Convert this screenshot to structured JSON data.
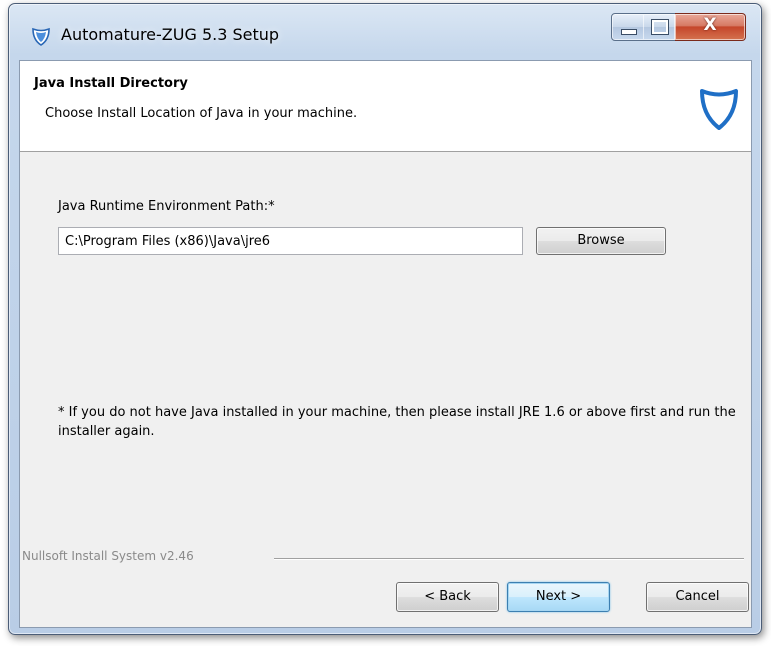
{
  "window": {
    "title": "Automature-ZUG 5.3 Setup",
    "controls": {
      "minimize": "minimize",
      "maximize": "maximize",
      "close": "X"
    }
  },
  "header": {
    "title": "Java Install Directory",
    "subtitle": "Choose Install Location of Java in your machine.",
    "logo_icon": "shield-logo-icon"
  },
  "form": {
    "label": "Java Runtime Environment Path:*",
    "path_value": "C:\\Program Files (x86)\\Java\\jre6",
    "browse_label": "Browse"
  },
  "note": "* If you do not have Java installed in your machine, then please install JRE 1.6 or above first and run the installer again.",
  "footer": {
    "branding": "Nullsoft Install System v2.46",
    "back_label": "< Back",
    "next_label": "Next >",
    "cancel_label": "Cancel"
  },
  "colors": {
    "accent": "#3c7fb1",
    "logo_blue": "#1f6fc6"
  }
}
